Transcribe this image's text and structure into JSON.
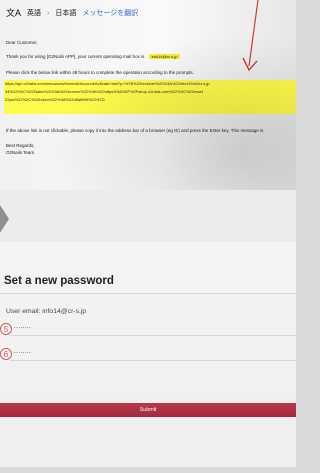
{
  "email": {
    "toolbar": {
      "translate_label": "英語",
      "language_label": "日本語",
      "message_link": "メッセージを翻訳"
    },
    "greeting": "Dear Customer,",
    "thanks_text": "Thank you for using [O2Nails APP], your current operating mail box is",
    "instruction_text": "Please click the below link within 48 hours to complete the operation according to the prompts.",
    "link_lines": [
      "https://api.o2nails.com/resources/bin/mail/Account/Activate.html?p=%7B%22receiver%22%3A%22info14%40cr-s.jp",
      "34%22%2C%22Nails%22%3A%22service%22%3A%22https%3A%2F%2Fshop.o2nails.com%22%2C%22reset",
      "22pw%22%2C%22token%22%3A%22d5af689%22%7D"
    ],
    "fallback_text": "If the above link is not clickable, please copy it into the address bar of a browser (eg IE) and press the Enter key. This message is",
    "sign_off": "Best Regards,",
    "team": "O2Nails Team"
  },
  "form": {
    "title": "Set a new password",
    "user_email": "User email: info14@cr-s.jp",
    "fields": [
      {
        "marker": "5",
        "value": "........"
      },
      {
        "marker": "6",
        "value": "........"
      }
    ],
    "submit_label": "Submit"
  },
  "colors": {
    "highlight": "#fffb4c",
    "submit": "#a52b3d",
    "annotation": "#d33a3a"
  },
  "icons": {
    "translate": "translate-icon",
    "arrow": "annotation-arrow-icon",
    "chevron": "left-chevron-icon"
  }
}
